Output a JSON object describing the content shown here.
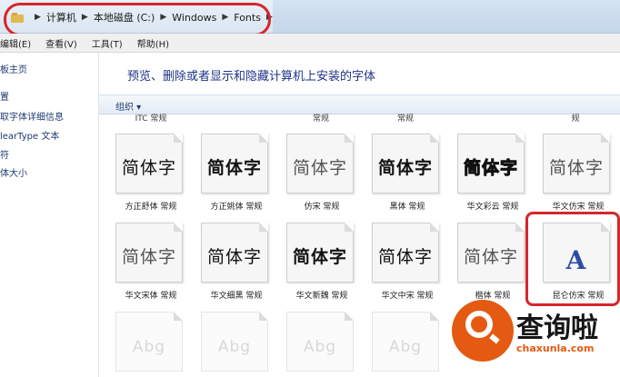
{
  "breadcrumb": {
    "items": [
      "计算机",
      "本地磁盘 (C:)",
      "Windows",
      "Fonts"
    ]
  },
  "menu": {
    "items": [
      "编辑(E)",
      "查看(V)",
      "工具(T)",
      "帮助(H)"
    ]
  },
  "sidebar": {
    "items": [
      "板主页",
      "置",
      "取字体详细信息",
      "learType 文本",
      "符",
      "体大小"
    ]
  },
  "header": {
    "title": "预览、删除或者显示和隐藏计算机上安装的字体"
  },
  "toolbar": {
    "organize_label": "组织 ▾"
  },
  "fonts": {
    "top_partial_labels": [
      "ITC 常规",
      "常规",
      "常规",
      "规"
    ],
    "row1": [
      {
        "preview": "简体字",
        "label": "方正舒体 常规"
      },
      {
        "preview": "简体字",
        "label": "方正姚体 常规"
      },
      {
        "preview": "简体字",
        "label": "仿宋 常规"
      },
      {
        "preview": "简体字",
        "label": "黑体 常规"
      },
      {
        "preview": "简体字",
        "label": "华文彩云 常规"
      },
      {
        "preview": "简体字",
        "label": "华文仿宋 常规"
      }
    ],
    "row2": [
      {
        "preview": "简体字",
        "label": "华文宋体 常规"
      },
      {
        "preview": "简体字",
        "label": "华文细黑 常规"
      },
      {
        "preview": "简体字",
        "label": "华文新魏 常规"
      },
      {
        "preview": "简体字",
        "label": "华文中宋 常规"
      },
      {
        "preview": "简体字",
        "label": "楷体 常规"
      },
      {
        "preview": "A",
        "label": "昆仑仿宋 常规"
      }
    ],
    "row3": [
      {
        "preview": "Abg"
      },
      {
        "preview": "Abg"
      },
      {
        "preview": "Abg"
      },
      {
        "preview": "Abg"
      }
    ]
  },
  "watermark": {
    "title": "查询啦",
    "url": "chaxunla.com"
  },
  "colors": {
    "annotation_red": "#d6262b",
    "watermark_orange": "#e45a12",
    "header_blue": "#1e3287"
  }
}
